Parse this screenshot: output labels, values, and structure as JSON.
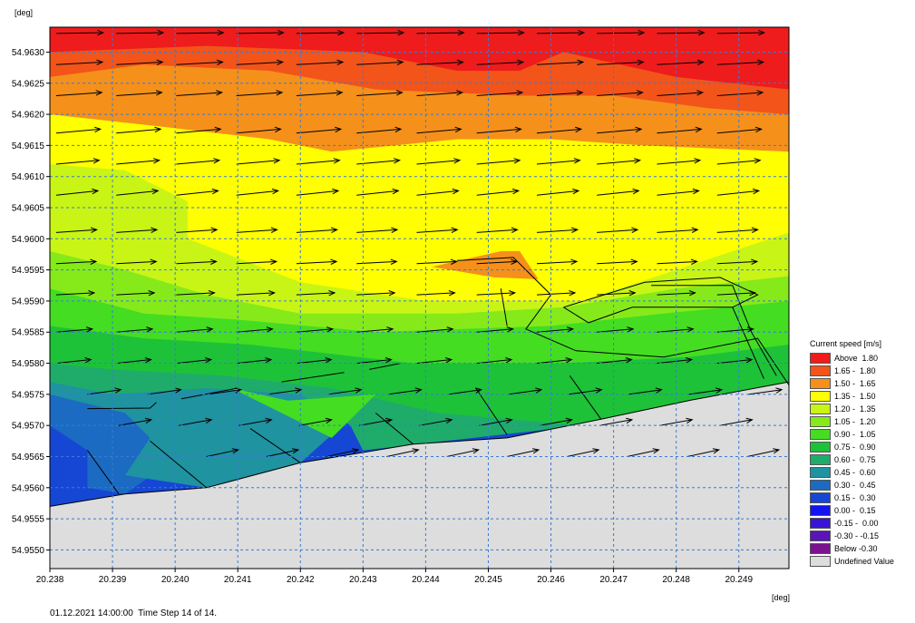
{
  "y_unit": "[deg]",
  "x_unit": "[deg]",
  "footer": {
    "datetime": "01.12.2021 14:00:00",
    "step": "Time Step 14 of 14."
  },
  "legend": {
    "title": "Current speed [m/s]",
    "entries": [
      {
        "label": "Above  1.80",
        "color": "#ee1c1c"
      },
      {
        "label": "1.65 -  1.80",
        "color": "#f2541a"
      },
      {
        "label": "1.50 -  1.65",
        "color": "#f5901a"
      },
      {
        "label": "1.35 -  1.50",
        "color": "#ffff00"
      },
      {
        "label": "1.20 -  1.35",
        "color": "#c8f515"
      },
      {
        "label": "1.05 -  1.20",
        "color": "#86ea1a"
      },
      {
        "label": "0.90 -  1.05",
        "color": "#44dd22"
      },
      {
        "label": "0.75 -  0.90",
        "color": "#1ec238"
      },
      {
        "label": "0.60 -  0.75",
        "color": "#1fac6a"
      },
      {
        "label": "0.45 -  0.60",
        "color": "#1f93a0"
      },
      {
        "label": "0.30 -  0.45",
        "color": "#1b6bc2"
      },
      {
        "label": "0.15 -  0.30",
        "color": "#1647d4"
      },
      {
        "label": "0.00 -  0.15",
        "color": "#1414f0"
      },
      {
        "label": "-0.15 -  0.00",
        "color": "#3a14d4"
      },
      {
        "label": "-0.30 - -0.15",
        "color": "#5a14b8"
      },
      {
        "label": "Below -0.30",
        "color": "#7a1292"
      },
      {
        "label": "Undefined Value",
        "color": "#dddddd"
      }
    ]
  },
  "chart_data": {
    "type": "heatmap",
    "title": "",
    "xlabel": "",
    "ylabel": "",
    "xlim": [
      20.238,
      20.2498
    ],
    "ylim": [
      54.9547,
      54.9634
    ],
    "x_ticks": [
      "20.238",
      "20.239",
      "20.240",
      "20.241",
      "20.242",
      "20.243",
      "20.244",
      "20.245",
      "20.246",
      "20.247",
      "20.248",
      "20.249"
    ],
    "y_ticks": [
      "54.9550",
      "54.9555",
      "54.9560",
      "54.9565",
      "54.9570",
      "54.9575",
      "54.9580",
      "54.9585",
      "54.9590",
      "54.9595",
      "54.9600",
      "54.9605",
      "54.9610",
      "54.9615",
      "54.9620",
      "54.9625",
      "54.9630"
    ],
    "grid": true,
    "legend_position": "right",
    "shoreline": [
      [
        20.238,
        54.9557
      ],
      [
        20.2392,
        54.9559
      ],
      [
        20.2405,
        54.956
      ],
      [
        20.242,
        54.9564
      ],
      [
        20.2438,
        54.9567
      ],
      [
        20.2453,
        54.9568
      ],
      [
        20.2468,
        54.9571
      ],
      [
        20.2482,
        54.9574
      ],
      [
        20.2498,
        54.9577
      ]
    ],
    "bands": [
      {
        "range": "Above  1.80",
        "top": [
          [
            20.238,
            54.9634
          ],
          [
            20.2498,
            54.9634
          ]
        ],
        "bottom": [
          [
            20.238,
            54.963
          ],
          [
            20.2405,
            54.9631
          ],
          [
            20.243,
            54.963
          ],
          [
            20.2445,
            54.9627
          ],
          [
            20.2455,
            54.9627
          ],
          [
            20.2462,
            54.963
          ],
          [
            20.248,
            54.9626
          ],
          [
            20.2498,
            54.9624
          ]
        ]
      },
      {
        "range": "1.65 -  1.80",
        "bottom": [
          [
            20.238,
            54.9626
          ],
          [
            20.2395,
            54.9628
          ],
          [
            20.2415,
            54.9627
          ],
          [
            20.2432,
            54.9624
          ],
          [
            20.2455,
            54.9623
          ],
          [
            20.247,
            54.9623
          ],
          [
            20.2485,
            54.9621
          ],
          [
            20.2498,
            54.962
          ]
        ]
      },
      {
        "range": "1.50 -  1.65",
        "bottom": [
          [
            20.238,
            54.962
          ],
          [
            20.2398,
            54.9618
          ],
          [
            20.2415,
            54.9616
          ],
          [
            20.2425,
            54.9614
          ],
          [
            20.2445,
            54.9616
          ],
          [
            20.246,
            54.9616
          ],
          [
            20.2475,
            54.9615
          ],
          [
            20.2498,
            54.9614
          ]
        ]
      },
      {
        "range": "1.35 -  1.50",
        "bottom": [
          [
            20.238,
            54.9612
          ],
          [
            20.2392,
            54.9611
          ],
          [
            20.2402,
            54.9606
          ],
          [
            20.2402,
            54.96
          ],
          [
            20.242,
            54.9593
          ],
          [
            20.244,
            54.959
          ],
          [
            20.2465,
            54.959
          ],
          [
            20.248,
            54.9595
          ],
          [
            20.2498,
            54.9601
          ]
        ]
      },
      {
        "range": "1.20 -  1.35",
        "bottom": [
          [
            20.238,
            54.9598
          ],
          [
            20.2392,
            54.9595
          ],
          [
            20.2405,
            54.9591
          ],
          [
            20.242,
            54.9588
          ],
          [
            20.2445,
            54.9588
          ],
          [
            20.2462,
            54.9589
          ],
          [
            20.248,
            54.9592
          ],
          [
            20.2498,
            54.9594
          ]
        ]
      },
      {
        "range": "1.05 -  1.20",
        "bottom": [
          [
            20.238,
            54.9592
          ],
          [
            20.2395,
            54.9588
          ],
          [
            20.241,
            54.9587
          ],
          [
            20.2432,
            54.9585
          ],
          [
            20.246,
            54.9586
          ],
          [
            20.2478,
            54.9588
          ],
          [
            20.2498,
            54.959
          ]
        ]
      },
      {
        "range": "0.90 -  1.05",
        "bottom": [
          [
            20.238,
            54.9586
          ],
          [
            20.2395,
            54.9584
          ],
          [
            20.2412,
            54.9583
          ],
          [
            20.2438,
            54.958
          ],
          [
            20.2462,
            54.958
          ],
          [
            20.2482,
            54.9581
          ],
          [
            20.2498,
            54.9583
          ]
        ]
      },
      {
        "range": "0.75 -  0.90",
        "bottom": [
          [
            20.238,
            54.958
          ],
          [
            20.239,
            54.9579
          ],
          [
            20.2408,
            54.9578
          ],
          [
            20.2425,
            54.9576
          ],
          [
            20.2442,
            54.9572
          ],
          [
            20.2465,
            54.957
          ],
          [
            20.249,
            54.9575
          ],
          [
            20.2498,
            54.9577
          ]
        ]
      },
      {
        "range": "0.60 -  0.75",
        "bottom": [
          [
            20.238,
            54.9577
          ],
          [
            20.239,
            54.9575
          ],
          [
            20.2405,
            54.9576
          ],
          [
            20.242,
            54.9575
          ],
          [
            20.2428,
            54.957
          ],
          [
            20.243,
            54.9566
          ],
          [
            20.2465,
            54.957
          ],
          [
            20.2498,
            54.9577
          ]
        ]
      },
      {
        "range": "0.45 -  0.60",
        "bottom": [
          [
            20.238,
            54.9575
          ],
          [
            20.2392,
            54.9572
          ],
          [
            20.2396,
            54.9568
          ],
          [
            20.2392,
            54.9562
          ],
          [
            20.2405,
            54.956
          ],
          [
            20.242,
            54.9564
          ]
        ]
      },
      {
        "range": "0.30 -  0.45",
        "bottom": [
          [
            20.238,
            54.957
          ],
          [
            20.2386,
            54.9566
          ],
          [
            20.2386,
            54.956
          ],
          [
            20.2392,
            54.9559
          ]
        ]
      },
      {
        "range": "0.15 -  0.30",
        "bottom": [
          [
            20.238,
            54.9566
          ],
          [
            20.2383,
            54.9563
          ],
          [
            20.2385,
            54.9559
          ]
        ]
      }
    ],
    "patches": [
      {
        "range": "1.50 -  1.65",
        "points": [
          [
            20.2441,
            54.95955
          ],
          [
            20.2452,
            54.9598
          ],
          [
            20.2455,
            54.9598
          ],
          [
            20.2458,
            54.95935
          ],
          [
            20.2451,
            54.95938
          ]
        ]
      },
      {
        "range": "0.90 -  1.05",
        "points": [
          [
            20.2409,
            54.9576
          ],
          [
            20.2418,
            54.9574
          ],
          [
            20.2432,
            54.9575
          ],
          [
            20.2425,
            54.9568
          ]
        ]
      }
    ],
    "vector_rows": [
      {
        "y": 54.9633,
        "x_start": 20.2381,
        "angle_deg": 1,
        "length_m": 1.85
      },
      {
        "y": 54.9628,
        "x_start": 20.2381,
        "angle_deg": 3,
        "length_m": 1.8
      },
      {
        "y": 54.9623,
        "x_start": 20.2381,
        "angle_deg": 4,
        "length_m": 1.75
      },
      {
        "y": 54.9617,
        "x_start": 20.2381,
        "angle_deg": 5,
        "length_m": 1.65
      },
      {
        "y": 54.9612,
        "x_start": 20.2381,
        "angle_deg": 5,
        "length_m": 1.55
      },
      {
        "y": 54.9607,
        "x_start": 20.2381,
        "angle_deg": 6,
        "length_m": 1.45
      },
      {
        "y": 54.9601,
        "x_start": 20.2381,
        "angle_deg": 4,
        "length_m": 1.35
      },
      {
        "y": 54.9596,
        "x_start": 20.2381,
        "angle_deg": 3,
        "length_m": 1.3
      },
      {
        "y": 54.9591,
        "x_start": 20.2381,
        "angle_deg": 3,
        "length_m": 1.15
      },
      {
        "y": 54.9585,
        "x_start": 20.2381,
        "angle_deg": 5,
        "length_m": 1.0
      },
      {
        "y": 54.958,
        "x_start": 20.2381,
        "angle_deg": 6,
        "length_m": 0.9
      },
      {
        "y": 54.9575,
        "x_start": 20.2386,
        "angle_deg": 8,
        "length_m": 0.8
      },
      {
        "y": 54.957,
        "x_start": 20.2391,
        "angle_deg": 10,
        "length_m": 0.75
      },
      {
        "y": 54.9565,
        "x_start": 20.2405,
        "angle_deg": 12,
        "length_m": 0.7
      }
    ]
  }
}
